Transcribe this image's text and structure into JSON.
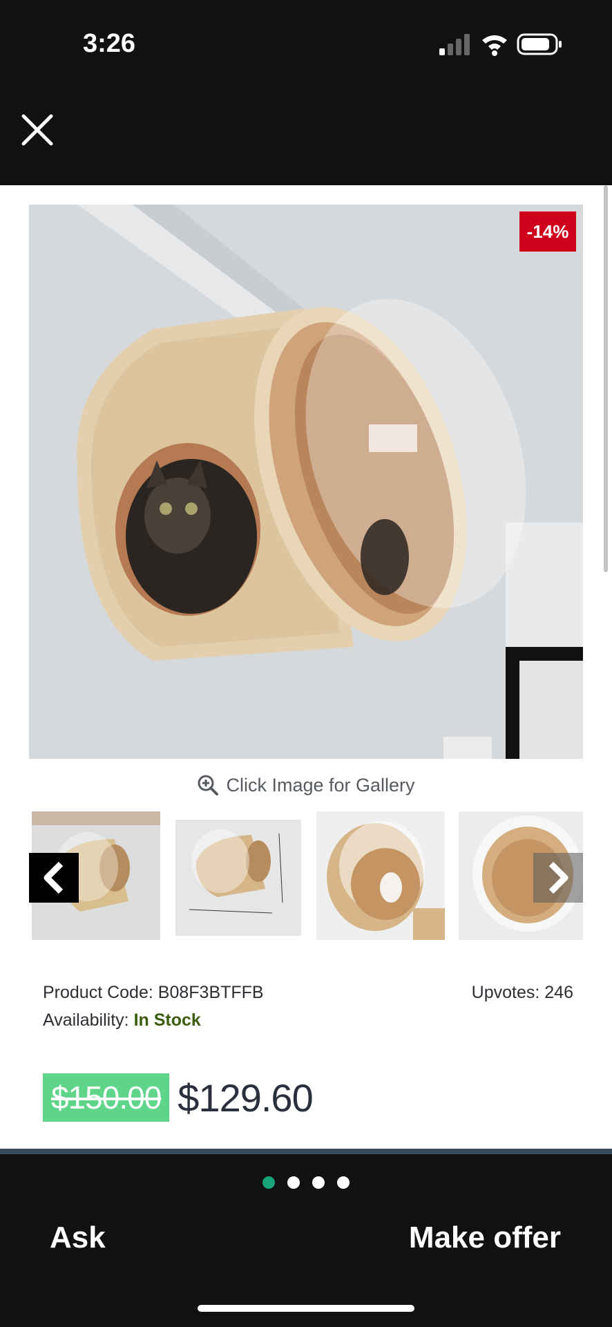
{
  "status_bar": {
    "time": "3:26"
  },
  "product": {
    "discount_badge": "-14%",
    "gallery_hint": "Click Image for Gallery",
    "product_code_label": "Product Code:",
    "product_code": "B08F3BTFFB",
    "upvotes_label": "Upvotes:",
    "upvotes": "246",
    "availability_label": "Availability:",
    "availability": "In Stock",
    "old_price": "$150.00",
    "new_price": "$129.60"
  },
  "pager": {
    "count": 4,
    "active_index": 0
  },
  "actions": {
    "ask_label": "Ask",
    "offer_label": "Make offer"
  },
  "colors": {
    "badge": "#d0021b",
    "old_price_bg": "#5fd58a",
    "in_stock": "#3b5d0d",
    "dot_active": "#1aa37a"
  }
}
